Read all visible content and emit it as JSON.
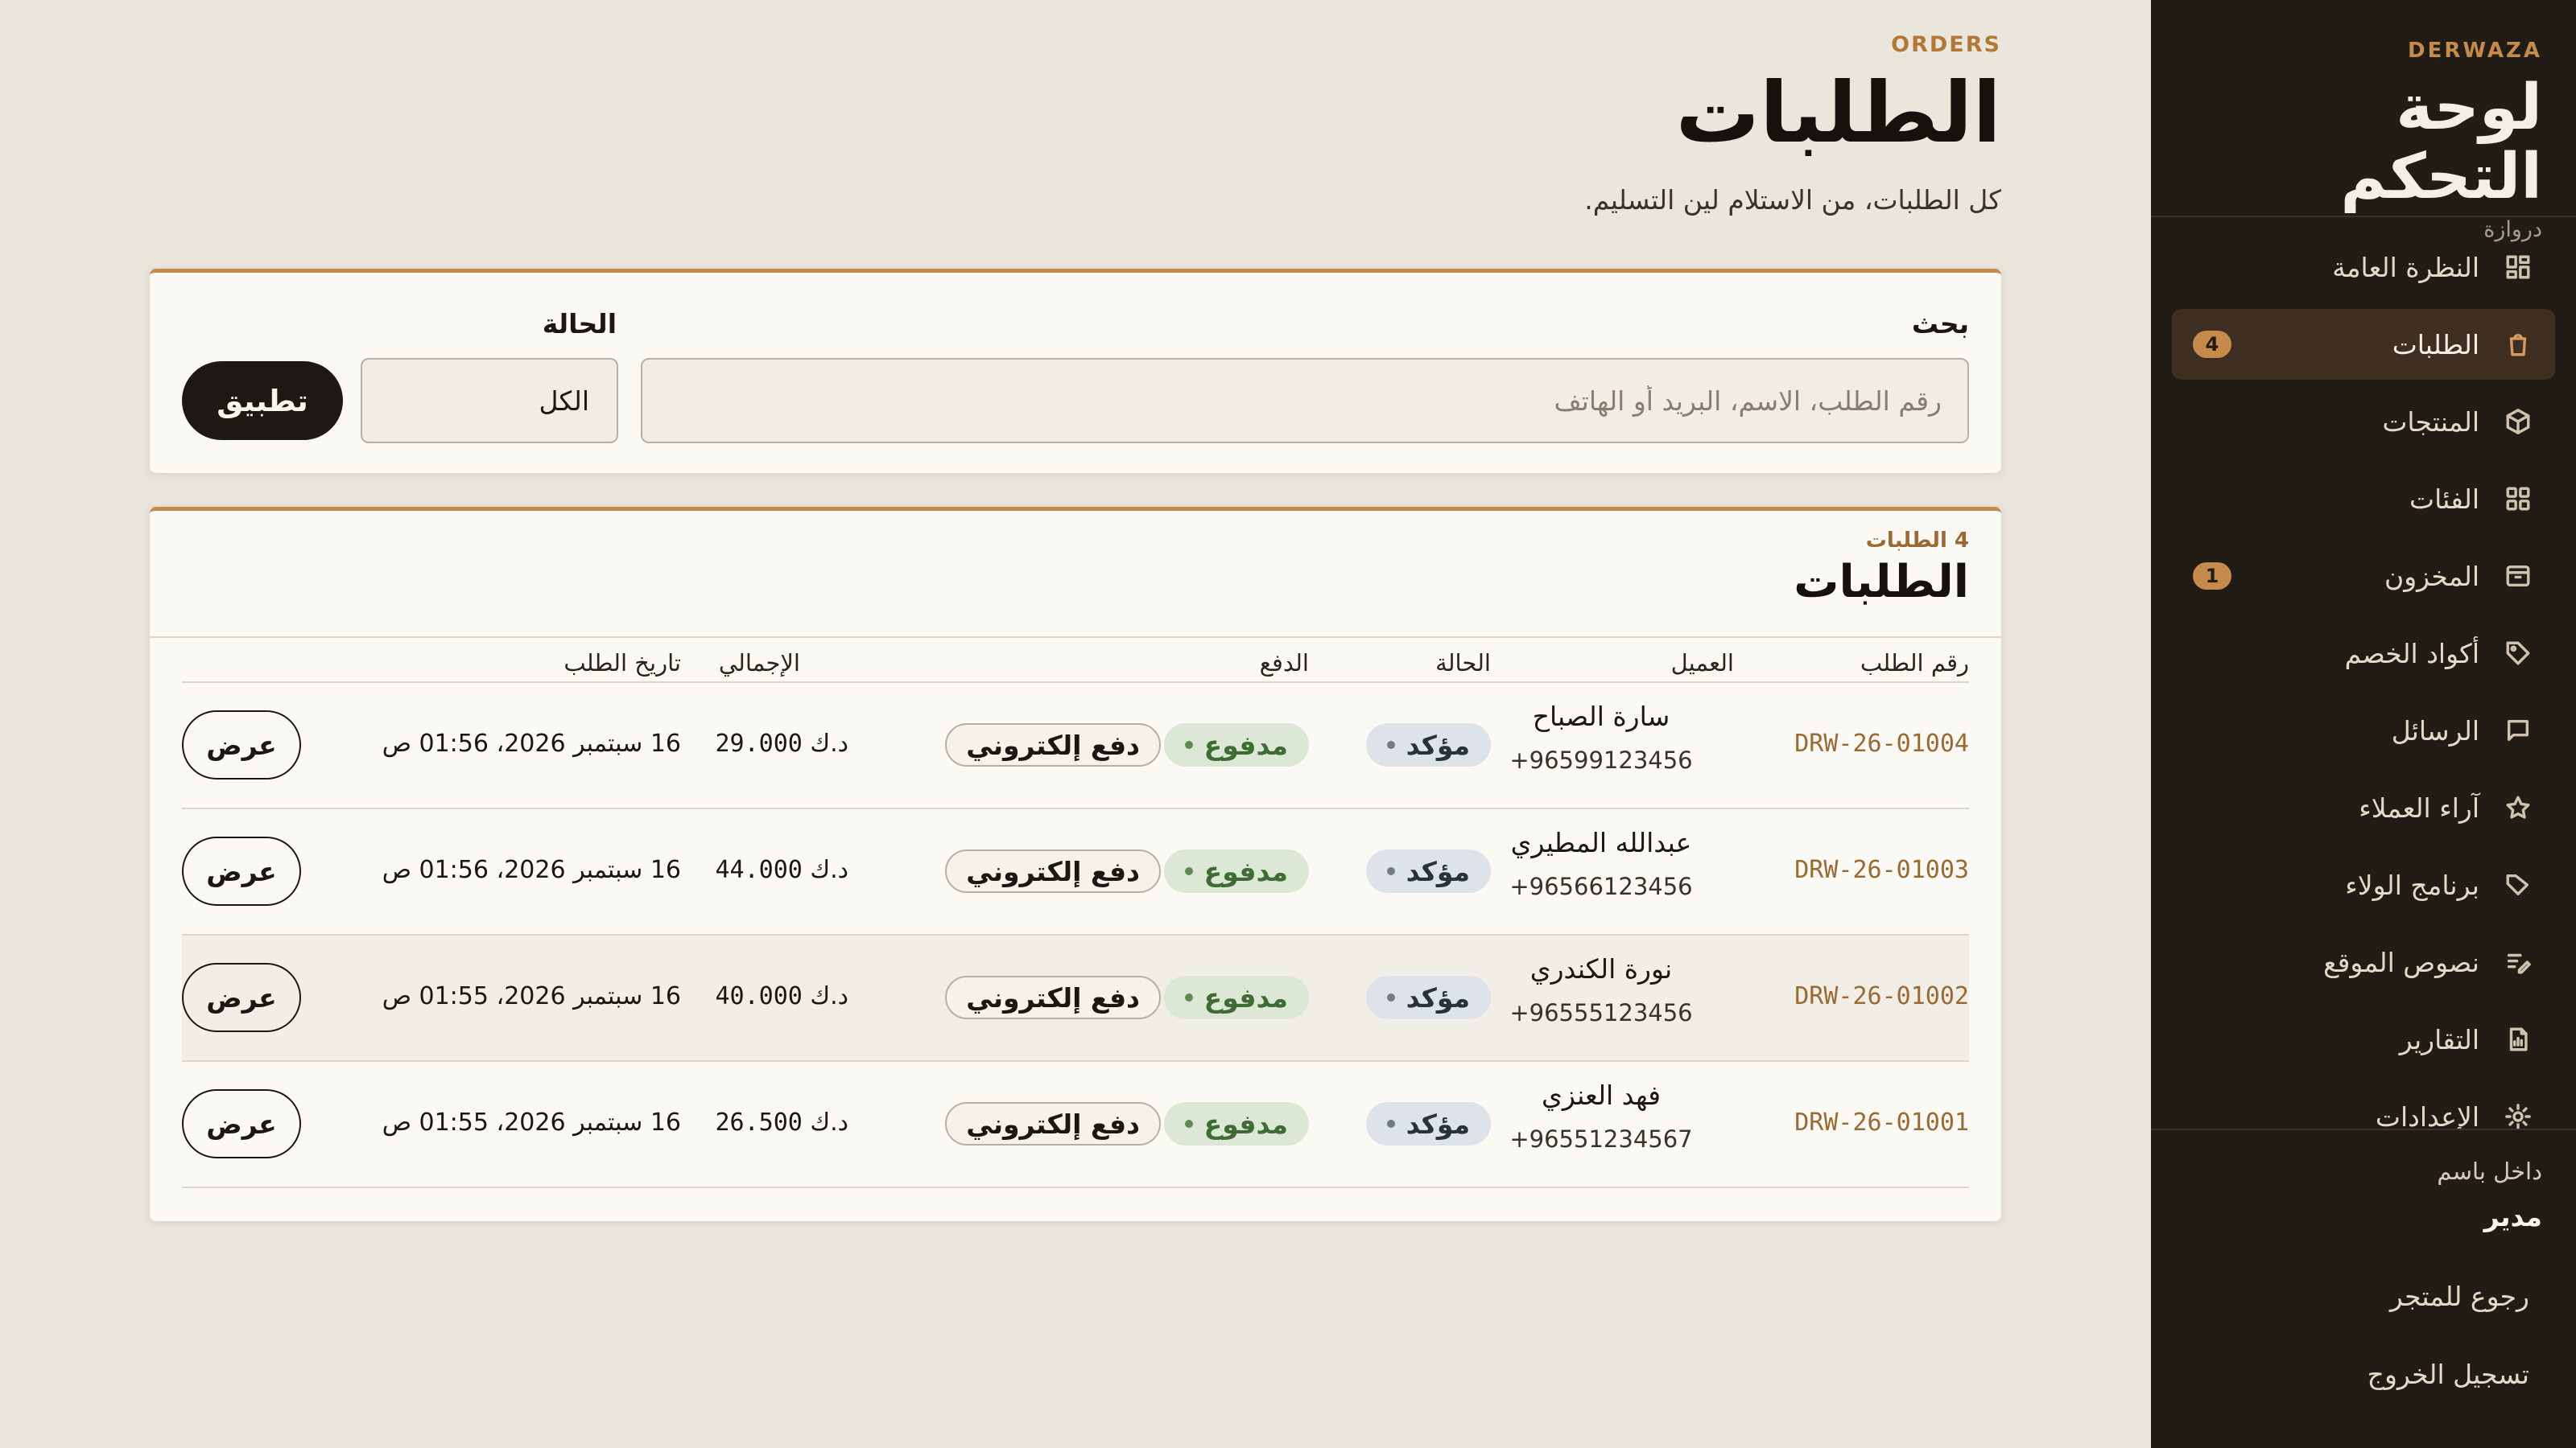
{
  "sidebar": {
    "brand_kicker": "DERWAZA",
    "brand_title": "لوحة التحكم",
    "brand_sub": "دروازة",
    "items": [
      {
        "label": "النظرة العامة",
        "icon": "dashboard-grid-icon"
      },
      {
        "label": "الطلبات",
        "icon": "shopping-bag-icon",
        "badge": "4",
        "active": true
      },
      {
        "label": "المنتجات",
        "icon": "box-icon"
      },
      {
        "label": "الفئات",
        "icon": "category-grid-icon"
      },
      {
        "label": "المخزون",
        "icon": "archive-icon",
        "badge": "1"
      },
      {
        "label": "أكواد الخصم",
        "icon": "tag-icon"
      },
      {
        "label": "الرسائل",
        "icon": "message-icon"
      },
      {
        "label": "آراء العملاء",
        "icon": "star-icon"
      },
      {
        "label": "برنامج الولاء",
        "icon": "loyalty-tag-icon"
      },
      {
        "label": "نصوص الموقع",
        "icon": "edit-text-icon"
      },
      {
        "label": "التقارير",
        "icon": "report-icon"
      },
      {
        "label": "الإعدادات",
        "icon": "gear-icon"
      }
    ],
    "user_kicker": "داخل باسم",
    "user_name": "مدير",
    "back_link": "رجوع للمتجر",
    "logout_link": "تسجيل الخروج"
  },
  "header": {
    "kicker": "ORDERS",
    "title": "الطلبات",
    "description": "كل الطلبات، من الاستلام لين التسليم."
  },
  "filters": {
    "search_label": "بحث",
    "search_placeholder": "رقم الطلب، الاسم، البريد أو الهاتف",
    "search_value": "",
    "status_label": "الحالة",
    "status_value": "الكل",
    "apply_label": "تطبيق"
  },
  "orders": {
    "count_label": "4 الطلبات",
    "title": "الطلبات",
    "columns": {
      "number": "رقم الطلب",
      "customer": "العميل",
      "status": "الحالة",
      "payment": "الدفع",
      "total": "الإجمالي",
      "date": "تاريخ الطلب"
    },
    "rows": [
      {
        "number": "DRW-26-01004",
        "name": "سارة الصباح",
        "phone": "+96599123456",
        "status": "مؤكد",
        "paid": "مدفوع",
        "method": "دفع إلكتروني",
        "amount": "29.000",
        "currency": "د.ك",
        "date": "16 سبتمبر 2026، 01:56 ص",
        "action": "عرض"
      },
      {
        "number": "DRW-26-01003",
        "name": "عبدالله المطيري",
        "phone": "+96566123456",
        "status": "مؤكد",
        "paid": "مدفوع",
        "method": "دفع إلكتروني",
        "amount": "44.000",
        "currency": "د.ك",
        "date": "16 سبتمبر 2026، 01:56 ص",
        "action": "عرض"
      },
      {
        "number": "DRW-26-01002",
        "name": "نورة الكندري",
        "phone": "+96555123456",
        "status": "مؤكد",
        "paid": "مدفوع",
        "method": "دفع إلكتروني",
        "amount": "40.000",
        "currency": "د.ك",
        "date": "16 سبتمبر 2026، 01:55 ص",
        "action": "عرض"
      },
      {
        "number": "DRW-26-01001",
        "name": "فهد العنزي",
        "phone": "+96551234567",
        "status": "مؤكد",
        "paid": "مدفوع",
        "method": "دفع إلكتروني",
        "amount": "26.500",
        "currency": "د.ك",
        "date": "16 سبتمبر 2026، 01:55 ص",
        "action": "عرض"
      }
    ]
  },
  "colors": {
    "accent": "#c48b4c",
    "sidebar_bg": "#221c16",
    "page_bg": "#ebe6dc",
    "confirmed_bg": "#dde3e9",
    "paid_bg": "#dde7d6"
  }
}
